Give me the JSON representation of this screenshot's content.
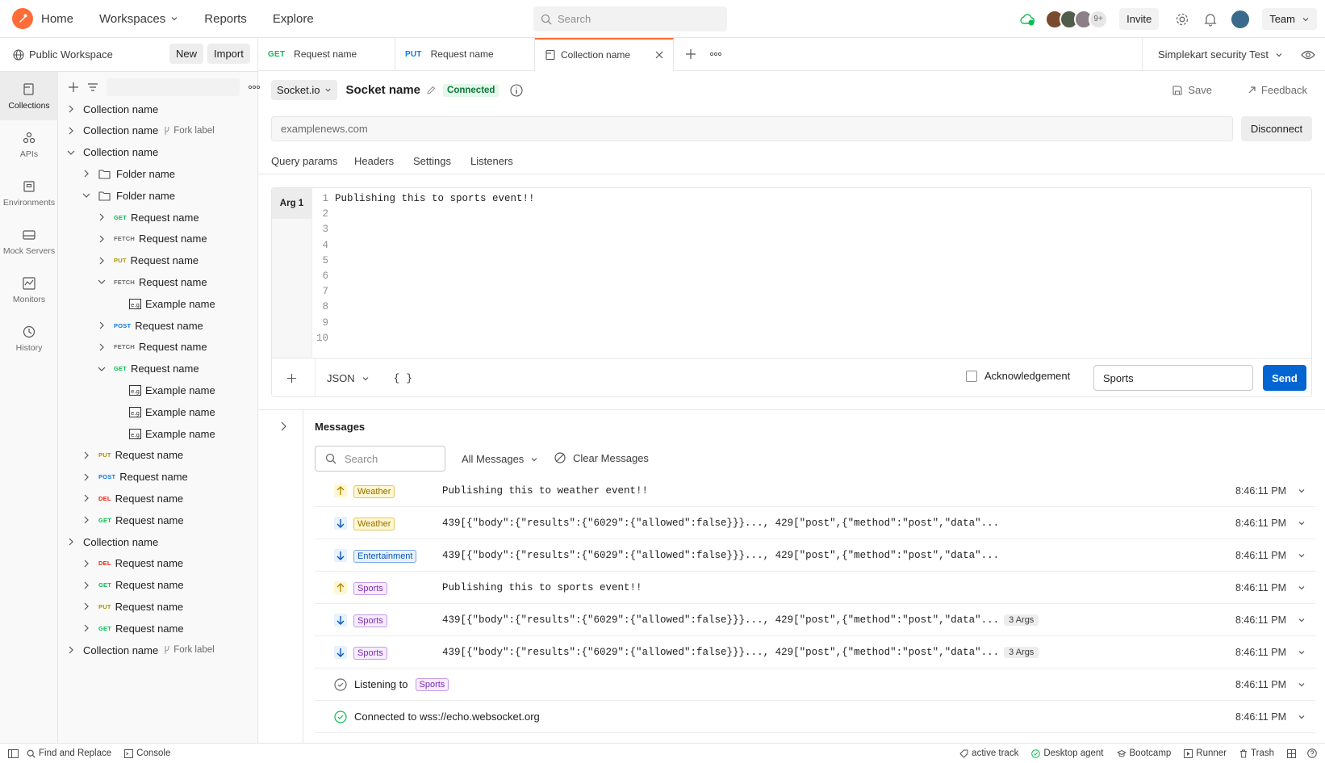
{
  "topbar": {
    "nav": [
      "Home",
      "Workspaces",
      "Reports",
      "Explore"
    ],
    "search_placeholder": "Search",
    "avatars_more": "9+",
    "invite_label": "Invite",
    "team_label": "Team"
  },
  "workspace": {
    "name": "Public Workspace",
    "new_label": "New",
    "import_label": "Import"
  },
  "rail": [
    {
      "label": "Collections",
      "icon": "collections-icon",
      "active": true
    },
    {
      "label": "APIs",
      "icon": "apis-icon"
    },
    {
      "label": "Environments",
      "icon": "environments-icon"
    },
    {
      "label": "Mock Servers",
      "icon": "mock-servers-icon"
    },
    {
      "label": "Monitors",
      "icon": "monitors-icon"
    },
    {
      "label": "History",
      "icon": "history-icon"
    }
  ],
  "tree": [
    {
      "kind": "collection",
      "label": "Collection name",
      "level": 0,
      "open": false
    },
    {
      "kind": "collection",
      "label": "Collection name",
      "level": 0,
      "open": false,
      "fork": "Fork label"
    },
    {
      "kind": "collection",
      "label": "Collection name",
      "level": 0,
      "open": true
    },
    {
      "kind": "folder",
      "label": "Folder name",
      "level": 1,
      "open": false
    },
    {
      "kind": "folder",
      "label": "Folder name",
      "level": 1,
      "open": true
    },
    {
      "kind": "request",
      "method": "GET",
      "label": "Request name",
      "level": 2,
      "open": false
    },
    {
      "kind": "request",
      "method": "FETCH",
      "label": "Request name",
      "level": 2,
      "open": false
    },
    {
      "kind": "request",
      "method": "PUT",
      "label": "Request name",
      "level": 2,
      "open": false
    },
    {
      "kind": "request",
      "method": "FETCH",
      "label": "Request name",
      "level": 2,
      "open": true
    },
    {
      "kind": "example",
      "label": "Example name",
      "level": 3
    },
    {
      "kind": "request",
      "method": "POST",
      "label": "Request name",
      "level": 2,
      "open": false
    },
    {
      "kind": "request",
      "method": "FETCH",
      "label": "Request name",
      "level": 2,
      "open": false
    },
    {
      "kind": "request",
      "method": "GET",
      "label": "Request name",
      "level": 2,
      "open": true
    },
    {
      "kind": "example",
      "label": "Example name",
      "level": 3
    },
    {
      "kind": "example",
      "label": "Example name",
      "level": 3
    },
    {
      "kind": "example",
      "label": "Example name",
      "level": 3
    },
    {
      "kind": "request",
      "method": "PUT",
      "label": "Request name",
      "level": 1,
      "open": false
    },
    {
      "kind": "request",
      "method": "POST",
      "label": "Request name",
      "level": 1,
      "open": false
    },
    {
      "kind": "request",
      "method": "DEL",
      "label": "Request name",
      "level": 1,
      "open": false
    },
    {
      "kind": "request",
      "method": "GET",
      "label": "Request name",
      "level": 1,
      "open": false
    },
    {
      "kind": "collection",
      "label": "Collection name",
      "level": 0,
      "open": false
    },
    {
      "kind": "request",
      "method": "DEL",
      "label": "Request name",
      "level": 1,
      "open": false
    },
    {
      "kind": "request",
      "method": "GET",
      "label": "Request name",
      "level": 1,
      "open": false
    },
    {
      "kind": "request",
      "method": "PUT",
      "label": "Request name",
      "level": 1,
      "open": false
    },
    {
      "kind": "request",
      "method": "GET",
      "label": "Request name",
      "level": 1,
      "open": false
    },
    {
      "kind": "collection",
      "label": "Collection name",
      "level": 0,
      "open": false,
      "fork": "Fork label"
    }
  ],
  "tabs": [
    {
      "method": "GET",
      "label": "Request name"
    },
    {
      "method": "PUT",
      "label": "Request name"
    },
    {
      "label": "Collection name",
      "active": true
    }
  ],
  "environment": "Simplekart security Test",
  "socket": {
    "type": "Socket.io",
    "name": "Socket name",
    "status": "Connected",
    "save_label": "Save",
    "feedback_label": "Feedback",
    "url": "examplenews.com",
    "disconnect_label": "Disconnect",
    "sub_tabs": [
      "Query params",
      "Headers",
      "Settings",
      "Listeners"
    ],
    "arg_label": "Arg 1",
    "editor_lines": [
      "Publishing this to sports event!!",
      "",
      "",
      "",
      "",
      "",
      "",
      "",
      "",
      ""
    ],
    "format": "JSON",
    "braces": "{ }",
    "ack_label": "Acknowledgement",
    "event_value": "Sports",
    "send_label": "Send"
  },
  "messages": {
    "title": "Messages",
    "search_placeholder": "Search",
    "filter": "All Messages",
    "clear_label": "Clear Messages",
    "rows": [
      {
        "dir": "up",
        "tag": "Weather",
        "text": "Publishing this to weather event!!",
        "time": "8:46:11 PM"
      },
      {
        "dir": "down",
        "tag": "Weather",
        "text": "439[{\"body\":{\"results\":{\"6029\":{\"allowed\":false}}}..., 429[\"post\",{\"method\":\"post\",\"data\"...",
        "time": "8:46:11 PM"
      },
      {
        "dir": "down",
        "tag": "Entertainment",
        "text": "439[{\"body\":{\"results\":{\"6029\":{\"allowed\":false}}}..., 429[\"post\",{\"method\":\"post\",\"data\"...",
        "time": "8:46:11 PM"
      },
      {
        "dir": "up",
        "tag": "Sports",
        "text": "Publishing this to sports event!!",
        "time": "8:46:11 PM"
      },
      {
        "dir": "down",
        "tag": "Sports",
        "text": "439[{\"body\":{\"results\":{\"6029\":{\"allowed\":false}}}..., 429[\"post\",{\"method\":\"post\",\"data\"...",
        "args": "3 Args",
        "time": "8:46:11 PM"
      },
      {
        "dir": "down",
        "tag": "Sports",
        "text": "439[{\"body\":{\"results\":{\"6029\":{\"allowed\":false}}}..., 429[\"post\",{\"method\":\"post\",\"data\"...",
        "args": "3 Args",
        "time": "8:46:11 PM"
      }
    ],
    "listening_label": "Listening to",
    "listening_tag": "Sports",
    "listening_time": "8:46:11 PM",
    "connected_text": "Connected to wss://echo.websocket.org",
    "connected_time": "8:46:11 PM"
  },
  "statusbar": {
    "find_replace": "Find and Replace",
    "console": "Console",
    "active_track": "active track",
    "desktop_agent": "Desktop agent",
    "bootcamp": "Bootcamp",
    "runner": "Runner",
    "trash": "Trash"
  },
  "colors": {
    "brand": "#ff6c37",
    "send": "#0265d2",
    "connected": "#0cbb52"
  }
}
